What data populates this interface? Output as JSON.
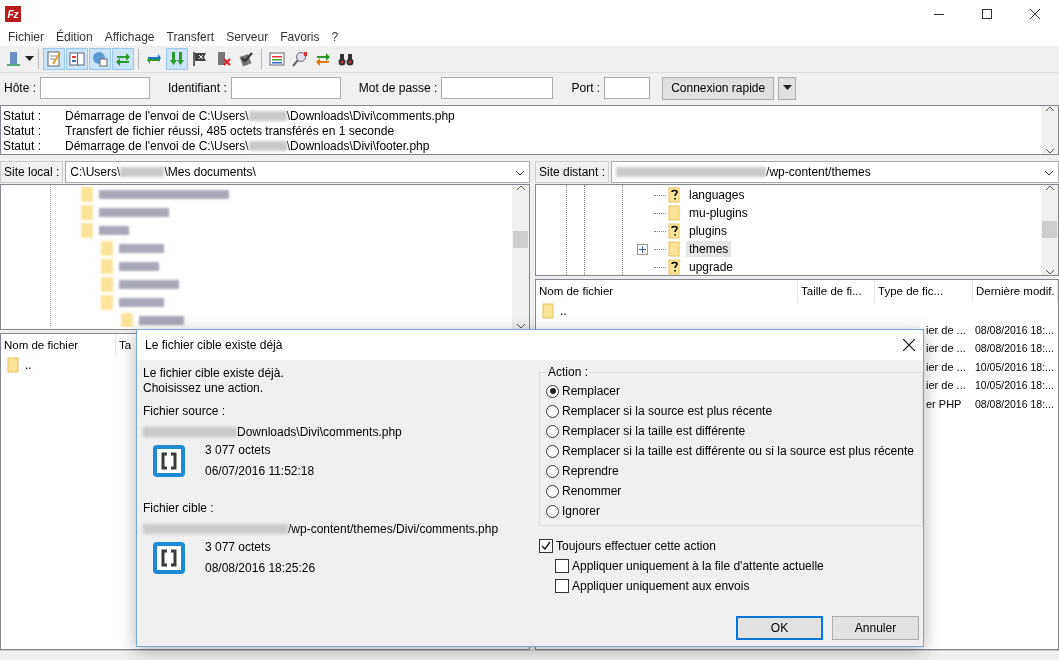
{
  "window": {
    "title_icon": "Fz"
  },
  "menu": [
    "Fichier",
    "Édition",
    "Affichage",
    "Transfert",
    "Serveur",
    "Favoris",
    "?"
  ],
  "toolbar": [
    {
      "kind": "server",
      "on": false
    },
    {
      "kind": "log",
      "on": true
    },
    {
      "kind": "localtree",
      "on": true
    },
    {
      "kind": "remotetree",
      "on": true
    },
    {
      "kind": "queue",
      "on": true
    },
    {
      "kind": "refresh",
      "on": false
    },
    {
      "kind": "process",
      "on": true
    },
    {
      "kind": "cancel",
      "on": false
    },
    {
      "kind": "disconnect",
      "on": false
    },
    {
      "kind": "reconnect",
      "on": false
    },
    {
      "kind": "filter",
      "on": false
    },
    {
      "kind": "compare",
      "on": false
    },
    {
      "kind": "sync",
      "on": false
    },
    {
      "kind": "search",
      "on": false
    }
  ],
  "quickconnect": {
    "host_label": "Hôte :",
    "user_label": "Identifiant :",
    "password_label": "Mot de passe :",
    "port_label": "Port :",
    "button": "Connexion rapide"
  },
  "log": [
    {
      "label": "Statut :",
      "parts": [
        "Démarrage de l'envoi de C:\\Users\\",
        "\\Downloads\\Divi\\comments.php"
      ]
    },
    {
      "label": "Statut :",
      "parts": [
        "Transfert de fichier réussi, 485 octets transférés en 1 seconde"
      ]
    },
    {
      "label": "Statut :",
      "parts": [
        "Démarrage de l'envoi de C:\\Users\\",
        "\\Downloads\\Divi\\footer.php"
      ]
    }
  ],
  "local": {
    "label": "Site local :",
    "parts": [
      "C:\\Users\\",
      "\\Mes documents\\"
    ],
    "columns": [
      "Nom de fichier",
      "Ta"
    ],
    "rows": [
      {
        "name": ".."
      }
    ]
  },
  "remote": {
    "label": "Site distant :",
    "parts": [
      "/wp-content/themes"
    ],
    "tree": [
      {
        "name": "languages",
        "kind": "unknown",
        "expandable": false,
        "selected": false
      },
      {
        "name": "mu-plugins",
        "kind": "folder",
        "expandable": false,
        "selected": false
      },
      {
        "name": "plugins",
        "kind": "unknown",
        "expandable": false,
        "selected": false
      },
      {
        "name": "themes",
        "kind": "folder",
        "expandable": true,
        "selected": true
      },
      {
        "name": "upgrade",
        "kind": "unknown",
        "expandable": false,
        "selected": false
      }
    ],
    "columns": [
      "Nom de fichier",
      "Taille de fi...",
      "Type de fic...",
      "Dernière modif."
    ],
    "parent_row": {
      "name": ".."
    },
    "rows": [
      {
        "type": "ier de ...",
        "date": "08/08/2016 18:..."
      },
      {
        "type": "ier de ...",
        "date": "08/08/2016 18:..."
      },
      {
        "type": "ier de ...",
        "date": "10/05/2016 18:..."
      },
      {
        "type": "ier de ...",
        "date": "10/05/2016 18:..."
      },
      {
        "type": "er PHP",
        "date": "08/08/2016 18:..."
      }
    ]
  },
  "dialog": {
    "title": "Le fichier cible existe déjà",
    "message": [
      "Le fichier cible existe déjà.",
      "Choisissez une action."
    ],
    "files": [
      {
        "label": "Fichier source :",
        "path": "Downloads\\Divi\\comments.php",
        "size": "3 077 octets",
        "date": "06/07/2016 11:52:18"
      },
      {
        "label": "Fichier cible :",
        "path": "/wp-content/themes/Divi/comments.php",
        "size": "3 077 octets",
        "date": "08/08/2016 18:25:26"
      }
    ],
    "action_label": "Action :",
    "actions": [
      {
        "label": "Remplacer",
        "selected": true
      },
      {
        "label": "Remplacer si la source est plus récente",
        "selected": false
      },
      {
        "label": "Remplacer si la taille est différente",
        "selected": false
      },
      {
        "label": "Remplacer si la taille est différente ou si la source est plus récente",
        "selected": false
      },
      {
        "label": "Reprendre",
        "selected": false
      },
      {
        "label": "Renommer",
        "selected": false
      },
      {
        "label": "Ignorer",
        "selected": false
      }
    ],
    "options": [
      {
        "label": "Toujours effectuer cette action",
        "checked": true,
        "children": [
          {
            "label": "Appliquer uniquement à la file d'attente actuelle",
            "checked": false
          },
          {
            "label": "Appliquer uniquement aux envois",
            "checked": false
          }
        ]
      }
    ],
    "buttons": [
      {
        "label": "OK",
        "default": true
      },
      {
        "label": "Annuler",
        "default": false
      }
    ]
  }
}
